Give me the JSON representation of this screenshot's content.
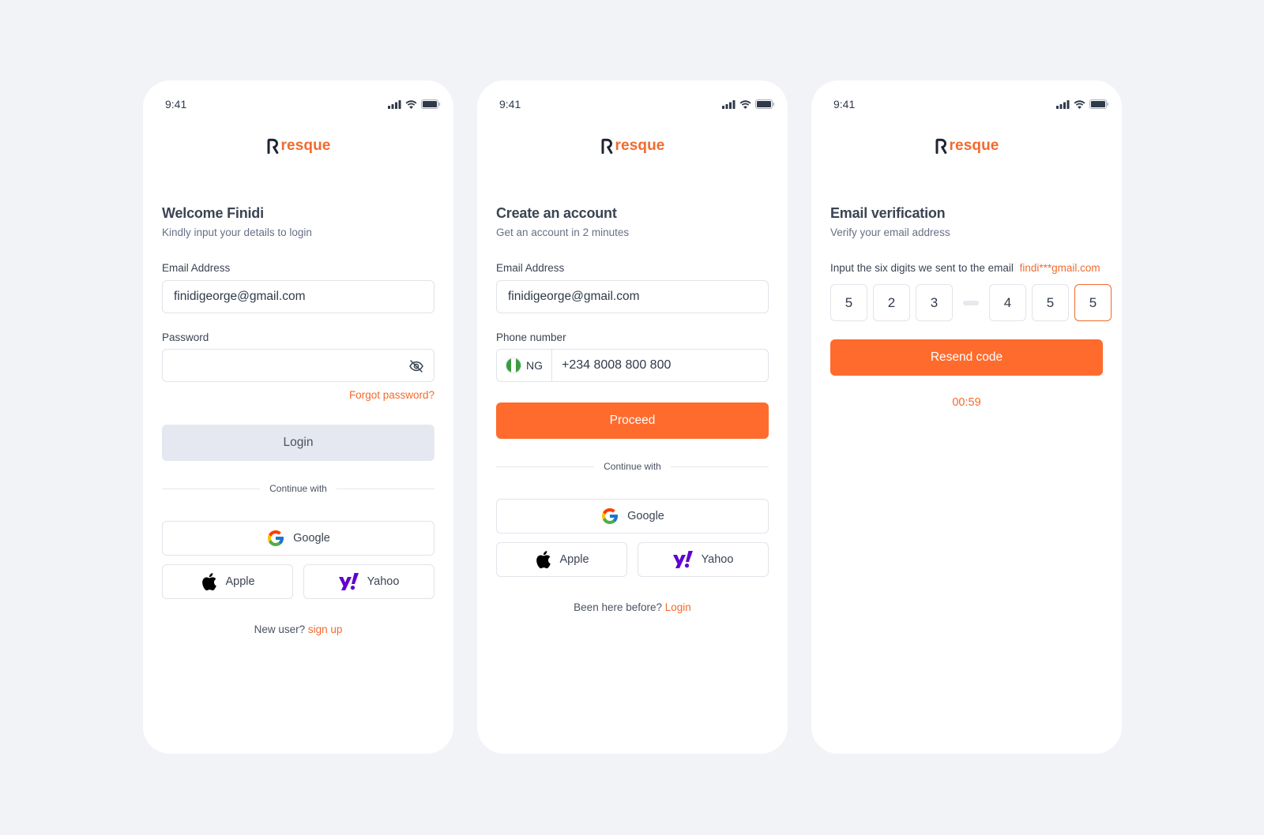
{
  "colors": {
    "accent": "#f26a2e",
    "primary_button": "#ff6b2c",
    "background": "#f1f3f7"
  },
  "brand": {
    "name": "resque"
  },
  "status_bar": {
    "time": "9:41",
    "icons": [
      "signal-icon",
      "wifi-icon",
      "battery-icon"
    ]
  },
  "login": {
    "title": "Welcome Finidi",
    "subtitle": "Kindly input your details to login",
    "email_label": "Email Address",
    "email_value": "finidigeorge@gmail.com",
    "password_label": "Password",
    "password_value": "",
    "forgot_password": "Forgot password?",
    "login_button": "Login",
    "continue_with": "Continue with",
    "google": "Google",
    "apple": "Apple",
    "yahoo": "Yahoo",
    "footer_text": "New user?",
    "footer_link": "sign up"
  },
  "signup": {
    "title": "Create an account",
    "subtitle": "Get an account in 2 minutes",
    "email_label": "Email Address",
    "email_value": "finidigeorge@gmail.com",
    "phone_label": "Phone number",
    "country_code": "NG",
    "phone_value": "+234 8008 800 800",
    "proceed_button": "Proceed",
    "continue_with": "Continue with",
    "google": "Google",
    "apple": "Apple",
    "yahoo": "Yahoo",
    "footer_text": "Been here before?",
    "footer_link": "Login"
  },
  "verify": {
    "title": "Email verification",
    "subtitle": "Verify your email address",
    "hint": "Input the six digits we sent to the email",
    "email_masked": "findi***gmail.com",
    "digits": [
      "5",
      "2",
      "3",
      "4",
      "5",
      "5"
    ],
    "resend_button": "Resend code",
    "timer": "00:59"
  }
}
